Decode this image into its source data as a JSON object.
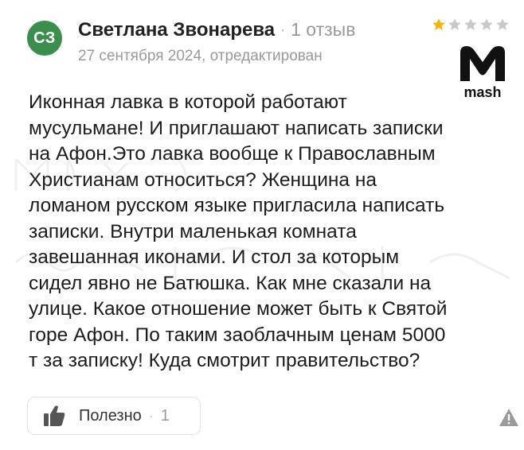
{
  "review": {
    "avatar_initials": "СЗ",
    "avatar_color": "#3c8e4d",
    "author_name": "Светлана Звонарева",
    "separator": "·",
    "reviews_count": "1 отзыв",
    "date": "27 сентября 2024, отредактирован",
    "rating": 1,
    "rating_max": 5,
    "star_filled_color": "#f7b500",
    "star_empty_color": "#c9c9c9",
    "lines": [
      "Иконная лавка в которой работают",
      "мусульмане! И приглашают написать записки",
      "на Афон.Это лавка вообще к Православным",
      "Христианам относиться? Женщина на",
      "ломаном русском языке пригласила написать",
      "записки. Внутри маленькая комната",
      "завешанная иконами. И стол за которым",
      "сидел явно не Батюшка. Как мне сказали на",
      "улице. Какое отношение может быть к Святой",
      "горе Афон. По таким заоблачным ценам 5000",
      "т за записку! Куда смотрит правительство?"
    ]
  },
  "logo": {
    "icon": "mash-m-logo",
    "text": "mash"
  },
  "actions": {
    "useful_label": "Полезно",
    "separator": "·",
    "useful_count": "1",
    "report_icon": "warning-triangle-icon"
  }
}
